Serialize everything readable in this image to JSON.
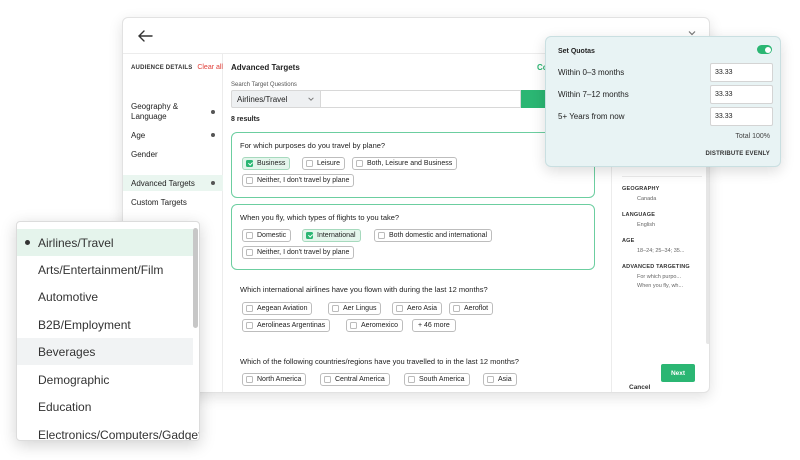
{
  "sidebar": {
    "header": "AUDIENCE DETAILS",
    "clear_label": "Clear all",
    "items": [
      {
        "label": "Geography & Language",
        "dot": true
      },
      {
        "label": "Age",
        "dot": true
      },
      {
        "label": "Gender",
        "dot": false
      },
      {
        "label": "Advanced Targets",
        "dot": true,
        "active": true
      },
      {
        "label": "Custom Targets",
        "dot": false
      }
    ]
  },
  "content": {
    "title": "Advanced Targets",
    "link": "Co",
    "search_label": "Search Target Questions",
    "search_select": "Airlines/Travel",
    "results": "8 results"
  },
  "questions": [
    {
      "text": "For which purposes do you travel by plane?",
      "options": [
        {
          "label": "Business",
          "checked": true
        },
        {
          "label": "Leisure",
          "checked": false
        },
        {
          "label": "Both, Leisure and Business",
          "checked": false
        },
        {
          "label": "Neither, I don't travel by plane",
          "checked": false
        }
      ]
    },
    {
      "text": "When you fly, which types of flights to you take?",
      "options": [
        {
          "label": "Domestic",
          "checked": false
        },
        {
          "label": "International",
          "checked": true
        },
        {
          "label": "Both domestic and international",
          "checked": false
        },
        {
          "label": "Neither, I don't travel by plane",
          "checked": false
        }
      ]
    },
    {
      "text": "Which international airlines have you flown with during the last 12 months?",
      "options": [
        {
          "label": "Aegean Aviation",
          "checked": false
        },
        {
          "label": "Aer Lingus",
          "checked": false
        },
        {
          "label": "Aero Asia",
          "checked": false
        },
        {
          "label": "Aeroflot",
          "checked": false
        },
        {
          "label": "Aerolineas Argentinas",
          "checked": false
        },
        {
          "label": "Aeromexico",
          "checked": false
        }
      ],
      "more": "+ 46 more"
    },
    {
      "text": "Which of the following countries/regions have you travelled to in the last 12 months?",
      "options": [
        {
          "label": "North America",
          "checked": false
        },
        {
          "label": "Central America",
          "checked": false
        },
        {
          "label": "South America",
          "checked": false
        },
        {
          "label": "Asia",
          "checked": false
        }
      ]
    }
  ],
  "summary": {
    "geography": {
      "heading": "GEOGRAPHY",
      "value": "Canada"
    },
    "language": {
      "heading": "LANGUAGE",
      "value": "English"
    },
    "age": {
      "heading": "AGE",
      "value": "18–24; 25–34; 35..."
    },
    "advanced": {
      "heading": "ADVANCED TARGETING",
      "values": [
        "For which purpo...",
        "When you fly, wh..."
      ]
    }
  },
  "actions": {
    "cancel": "Cancel",
    "next": "Next"
  },
  "quotas": {
    "title": "Set Quotas",
    "toggle_on": true,
    "rows": [
      {
        "label": "Within 0–3 months",
        "value": "33.33"
      },
      {
        "label": "Within 7–12 months",
        "value": "33.33"
      },
      {
        "label": "5+ Years from now",
        "value": "33.33"
      }
    ],
    "total": "Total 100%",
    "distribute": "DISTRIBUTE EVENLY"
  },
  "dropdown": {
    "items": [
      "Airlines/Travel",
      "Arts/Entertainment/Film",
      "Automotive",
      "B2B/Employment",
      "Beverages",
      "Demographic",
      "Education",
      "Electronics/Computers/Gadgets"
    ],
    "selected": 0,
    "hover": 4
  },
  "colors": {
    "accent": "#2bb673",
    "clear": "#e0403a",
    "selected_bg": "#e4f5ec"
  }
}
